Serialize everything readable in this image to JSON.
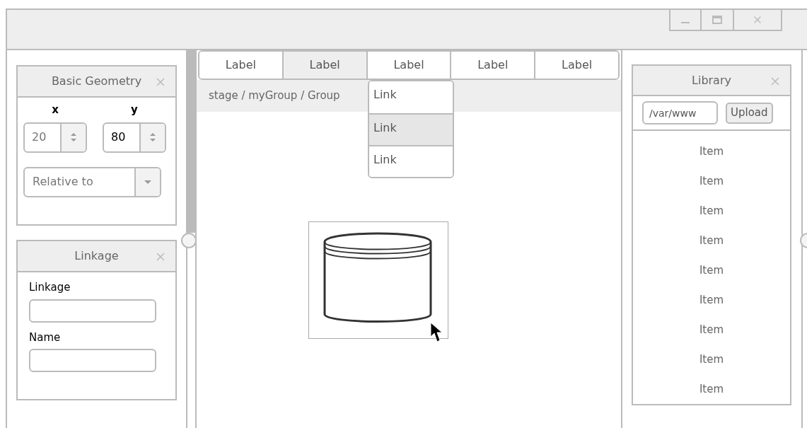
{
  "geometry_panel": {
    "title": "Basic Geometry",
    "x": {
      "label": "x",
      "placeholder": "20"
    },
    "y": {
      "label": "y",
      "value": "80"
    },
    "relative_to": {
      "placeholder": "Relative to"
    }
  },
  "linkage_panel": {
    "title": "Linkage",
    "fields": [
      {
        "label": "Linkage"
      },
      {
        "label": "Name"
      }
    ]
  },
  "tabs": [
    {
      "label": "Label",
      "selected": false
    },
    {
      "label": "Label",
      "selected": true
    },
    {
      "label": "Label",
      "selected": false
    },
    {
      "label": "Label",
      "selected": false
    },
    {
      "label": "Label",
      "selected": false
    }
  ],
  "breadcrumb": "stage / myGroup / Group",
  "dropdown": [
    {
      "label": "Link",
      "selected": false
    },
    {
      "label": "Link",
      "selected": true
    },
    {
      "label": "Link",
      "selected": false
    }
  ],
  "library_panel": {
    "title": "Library",
    "path": "/var/www",
    "upload": "Upload",
    "items": [
      "Item",
      "Item",
      "Item",
      "Item",
      "Item",
      "Item",
      "Item",
      "Item",
      "Item"
    ]
  }
}
